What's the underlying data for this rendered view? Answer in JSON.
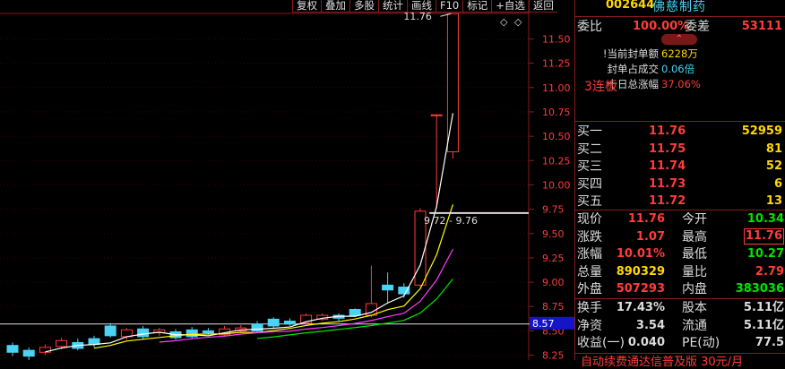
{
  "toolbar": [
    "复权",
    "叠加",
    "多股",
    "统计",
    "画线",
    "F10",
    "标记",
    "+自选",
    "返回"
  ],
  "stock": {
    "code": "002644",
    "name": "佛慈制药"
  },
  "order_ratio": {
    "label1": "委比",
    "value1": "100.00%",
    "label2": "委差",
    "value2": "53111"
  },
  "limit_info": {
    "streak": "3连板",
    "rows": [
      {
        "label": "!当前封单额",
        "value": "6228万"
      },
      {
        "label": "封单占成交",
        "value": "0.06倍"
      },
      {
        "label": "十日总涨幅",
        "value": "37.06%"
      }
    ]
  },
  "bids": [
    {
      "label": "买一",
      "price": "11.76",
      "vol": "52959"
    },
    {
      "label": "买二",
      "price": "11.75",
      "vol": "81"
    },
    {
      "label": "买三",
      "price": "11.74",
      "vol": "52"
    },
    {
      "label": "买四",
      "price": "11.73",
      "vol": "6"
    },
    {
      "label": "买五",
      "price": "11.72",
      "vol": "13"
    }
  ],
  "quote": [
    {
      "l1": "现价",
      "v1": "11.76",
      "c1": "red",
      "l2": "今开",
      "v2": "10.34",
      "c2": "green"
    },
    {
      "l1": "涨跌",
      "v1": "1.07",
      "c1": "red",
      "l2": "最高",
      "v2": "11.76",
      "c2": "red"
    },
    {
      "l1": "涨幅",
      "v1": "10.01%",
      "c1": "red",
      "l2": "最低",
      "v2": "10.27",
      "c2": "green"
    },
    {
      "l1": "总量",
      "v1": "890329",
      "c1": "yel",
      "l2": "量比",
      "v2": "2.79",
      "c2": "red"
    },
    {
      "l1": "外盘",
      "v1": "507293",
      "c1": "red",
      "l2": "内盘",
      "v2": "383036",
      "c2": "green"
    }
  ],
  "quote2": [
    {
      "l1": "换手",
      "v1": "17.43%",
      "l2": "股本",
      "v2": "5.11亿"
    },
    {
      "l1": "净资",
      "v1": "3.54",
      "l2": "流通",
      "v2": "5.11亿"
    },
    {
      "l1": "收益(一)",
      "v1": "0.040",
      "l2": "PE(动)",
      "v2": "77.5"
    }
  ],
  "ticker": "自动续费通达信普及版 30元/月",
  "chart_data": {
    "type": "candlestick",
    "y_ticks": [
      "11.50",
      "11.25",
      "11.00",
      "10.75",
      "10.50",
      "10.25",
      "10.00",
      "9.75",
      "9.50",
      "9.25",
      "9.00",
      "8.75",
      "8.50",
      "8.25"
    ],
    "ylim": [
      8.2,
      11.9
    ],
    "annotations": {
      "high": "11.76",
      "range": "9.72 - 9.76",
      "price_line": "8.57"
    },
    "candles": [
      {
        "o": 8.35,
        "c": 8.28,
        "h": 8.38,
        "l": 8.24
      },
      {
        "o": 8.3,
        "c": 8.24,
        "h": 8.33,
        "l": 8.2
      },
      {
        "o": 8.28,
        "c": 8.33,
        "h": 8.36,
        "l": 8.25
      },
      {
        "o": 8.34,
        "c": 8.4,
        "h": 8.43,
        "l": 8.31
      },
      {
        "o": 8.38,
        "c": 8.32,
        "h": 8.42,
        "l": 8.3
      },
      {
        "o": 8.42,
        "c": 8.36,
        "h": 8.45,
        "l": 8.33
      },
      {
        "o": 8.55,
        "c": 8.45,
        "h": 8.58,
        "l": 8.43
      },
      {
        "o": 8.44,
        "c": 8.51,
        "h": 8.53,
        "l": 8.41
      },
      {
        "o": 8.52,
        "c": 8.44,
        "h": 8.55,
        "l": 8.41
      },
      {
        "o": 8.48,
        "c": 8.51,
        "h": 8.53,
        "l": 8.45
      },
      {
        "o": 8.49,
        "c": 8.43,
        "h": 8.52,
        "l": 8.41
      },
      {
        "o": 8.51,
        "c": 8.44,
        "h": 8.54,
        "l": 8.42
      },
      {
        "o": 8.5,
        "c": 8.48,
        "h": 8.53,
        "l": 8.46
      },
      {
        "o": 8.46,
        "c": 8.52,
        "h": 8.55,
        "l": 8.44
      },
      {
        "o": 8.5,
        "c": 8.53,
        "h": 8.56,
        "l": 8.48
      },
      {
        "o": 8.57,
        "c": 8.5,
        "h": 8.6,
        "l": 8.48
      },
      {
        "o": 8.62,
        "c": 8.55,
        "h": 8.64,
        "l": 8.53
      },
      {
        "o": 8.6,
        "c": 8.57,
        "h": 8.63,
        "l": 8.55
      },
      {
        "o": 8.58,
        "c": 8.66,
        "h": 8.68,
        "l": 8.56
      },
      {
        "o": 8.62,
        "c": 8.66,
        "h": 8.68,
        "l": 8.6
      },
      {
        "o": 8.66,
        "c": 8.63,
        "h": 8.68,
        "l": 8.6
      },
      {
        "o": 8.72,
        "c": 8.66,
        "h": 8.73,
        "l": 8.64
      },
      {
        "o": 8.66,
        "c": 8.78,
        "h": 9.17,
        "l": 8.64
      },
      {
        "o": 8.97,
        "c": 8.92,
        "h": 9.1,
        "l": 8.78
      },
      {
        "o": 8.95,
        "c": 8.88,
        "h": 8.99,
        "l": 8.84
      },
      {
        "o": 8.97,
        "c": 9.73,
        "h": 9.76,
        "l": 8.95
      },
      {
        "o": 10.72,
        "c": 10.72,
        "h": 10.72,
        "l": 9.76
      },
      {
        "o": 10.34,
        "c": 11.76,
        "h": 11.76,
        "l": 10.27
      }
    ]
  }
}
